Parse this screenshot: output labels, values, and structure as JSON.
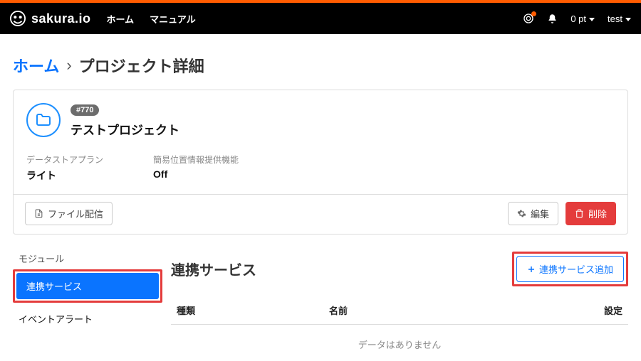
{
  "nav": {
    "brand": "sakura.io",
    "links": {
      "home": "ホーム",
      "manual": "マニュアル"
    },
    "points": "0 pt",
    "user": "test"
  },
  "breadcrumb": {
    "home": "ホーム",
    "current": "プロジェクト詳細"
  },
  "project": {
    "id_badge": "#770",
    "name": "テストプロジェクト",
    "plan_label": "データストアプラン",
    "plan_value": "ライト",
    "loc_label": "簡易位置情報提供機能",
    "loc_value": "Off"
  },
  "actions": {
    "file_delivery": "ファイル配信",
    "edit": "編集",
    "delete": "削除"
  },
  "sidebar": {
    "module": "モジュール",
    "services": "連携サービス",
    "alert": "イベントアラート"
  },
  "services": {
    "title": "連携サービス",
    "add": "連携サービス追加",
    "cols": {
      "type": "種類",
      "name": "名前",
      "settings": "設定"
    },
    "empty": "データはありません"
  }
}
